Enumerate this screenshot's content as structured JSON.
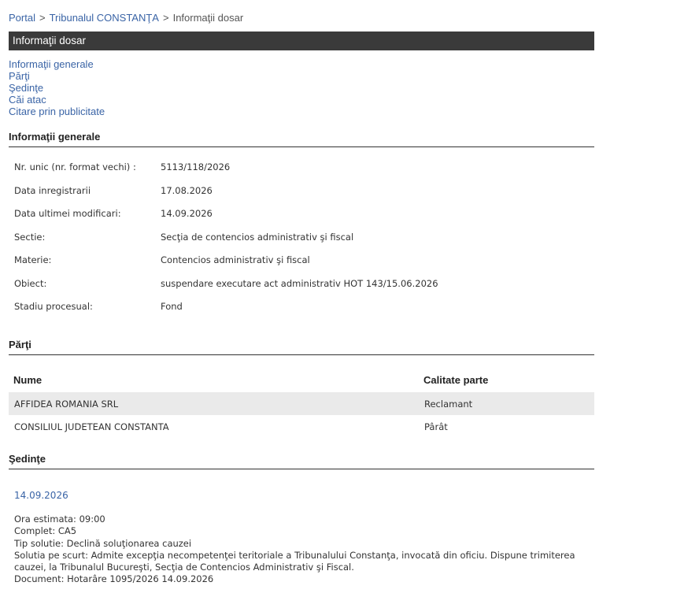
{
  "breadcrumb": {
    "items": [
      "Portal",
      "Tribunalul CONSTANŢA"
    ],
    "current": "Informaţii dosar",
    "separator": ">"
  },
  "page_title": "Informaţii dosar",
  "toc": [
    "Informaţii generale",
    "Părţi",
    "Şedinţe",
    "Căi atac",
    "Citare prin publicitate"
  ],
  "sections": {
    "general": "Informaţii generale",
    "parti": "Părţi",
    "sedinte": "Şedinţe"
  },
  "general_info": [
    {
      "label": "Nr. unic (nr. format vechi) :",
      "value": "5113/118/2026"
    },
    {
      "label": "Data inregistrarii",
      "value": "17.08.2026"
    },
    {
      "label": "Data ultimei modificari:",
      "value": "14.09.2026"
    },
    {
      "label": "Sectie:",
      "value": "Secţia de contencios administrativ şi fiscal"
    },
    {
      "label": "Materie:",
      "value": "Contencios administrativ şi fiscal"
    },
    {
      "label": "Obiect:",
      "value": "suspendare executare act administrativ HOT 143/15.06.2026"
    },
    {
      "label": "Stadiu procesual:",
      "value": "Fond"
    }
  ],
  "parti_table": {
    "headers": [
      "Nume",
      "Calitate parte"
    ],
    "rows": [
      [
        "AFFIDEA ROMANIA SRL",
        "Reclamant"
      ],
      [
        "CONSILIUL JUDETEAN CONSTANTA",
        "Pârât"
      ]
    ]
  },
  "sedinte": {
    "date": "14.09.2026",
    "lines": [
      "Ora estimata: 09:00",
      "Complet: CA5",
      "Tip solutie: Declină soluţionarea cauzei",
      "Solutia pe scurt: Admite excepţia necompetenţei teritoriale a Tribunalului Constanţa, invocată din oficiu. Dispune trimiterea cauzei, la Tribunalul Bucureşti, Secţia de Contencios Administrativ şi Fiscal.",
      "Document: Hotarâre  1095/2026  14.09.2026"
    ]
  },
  "colors": {
    "link": "#3a64a6",
    "title_bar": "#3a3a3a",
    "row_alt": "#eaeaea"
  }
}
